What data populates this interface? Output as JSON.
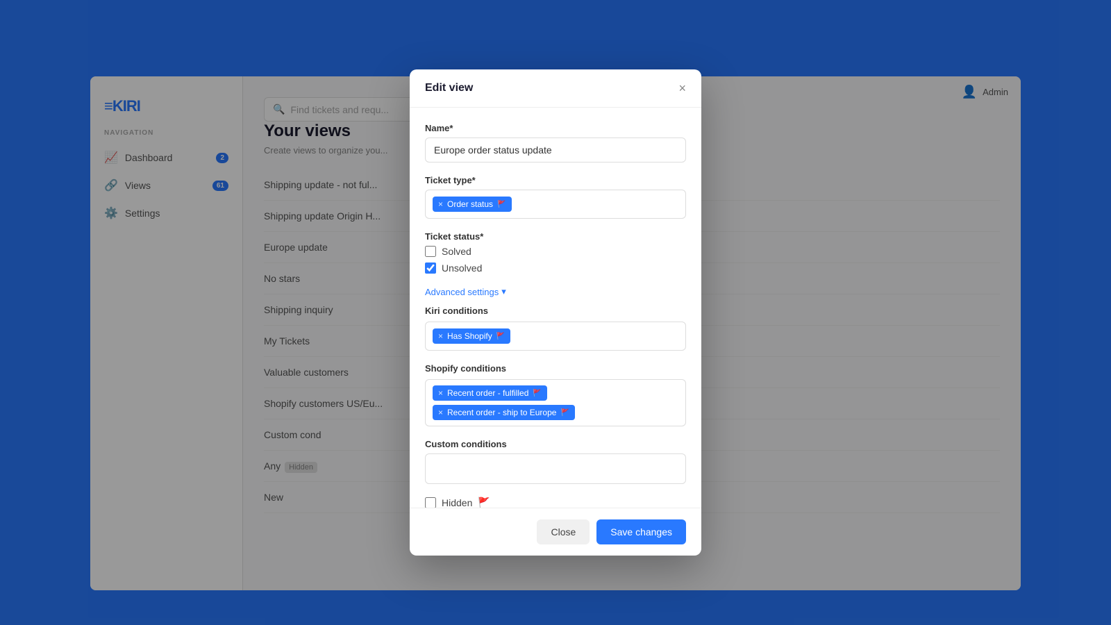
{
  "app": {
    "logo": "≡KIRI",
    "background_color": "#2979FF"
  },
  "sidebar": {
    "nav_label": "NAVIGATION",
    "items": [
      {
        "id": "dashboard",
        "label": "Dashboard",
        "icon": "📈",
        "badge": "2"
      },
      {
        "id": "views",
        "label": "Views",
        "icon": "🔗",
        "badge": "61"
      },
      {
        "id": "settings",
        "label": "Settings",
        "icon": "⚙️",
        "badge": null
      }
    ],
    "collapse_icon": "«"
  },
  "search": {
    "placeholder": "Find tickets and requ..."
  },
  "page": {
    "title": "Your views",
    "subtitle": "Create views to organize you..."
  },
  "views_list": [
    {
      "label": "Shipping update - not ful..."
    },
    {
      "label": "Shipping update Origin H..."
    },
    {
      "label": "Europe update"
    },
    {
      "label": "No stars"
    },
    {
      "label": "Shipping inquiry"
    },
    {
      "label": "My Tickets"
    },
    {
      "label": "Valuable customers"
    },
    {
      "label": "Shopify customers US/Eu..."
    },
    {
      "label": "Custom cond"
    },
    {
      "label": "Any",
      "hidden": true
    },
    {
      "label": "New"
    }
  ],
  "modal": {
    "title": "Edit view",
    "close_label": "×",
    "name_label": "Name*",
    "name_value": "Europe order status update",
    "ticket_type_label": "Ticket type*",
    "ticket_type_tags": [
      {
        "label": "Order status",
        "info": "🚩"
      }
    ],
    "ticket_status_label": "Ticket status*",
    "ticket_status_options": [
      {
        "label": "Solved",
        "checked": false
      },
      {
        "label": "Unsolved",
        "checked": true
      }
    ],
    "advanced_settings_label": "Advanced settings",
    "advanced_chevron": "▾",
    "kiri_conditions_label": "Kiri conditions",
    "kiri_conditions_tags": [
      {
        "label": "Has Shopify",
        "info": "🚩"
      }
    ],
    "shopify_conditions_label": "Shopify conditions",
    "shopify_conditions_tags": [
      {
        "label": "Recent order - fulfilled",
        "info": "🚩"
      },
      {
        "label": "Recent order - ship to Europe",
        "info": "🚩"
      }
    ],
    "custom_conditions_label": "Custom conditions",
    "custom_conditions_value": "",
    "hidden_label": "Hidden",
    "hidden_info": "🚩",
    "hidden_checked": false,
    "close_button_label": "Close",
    "save_button_label": "Save changes"
  }
}
